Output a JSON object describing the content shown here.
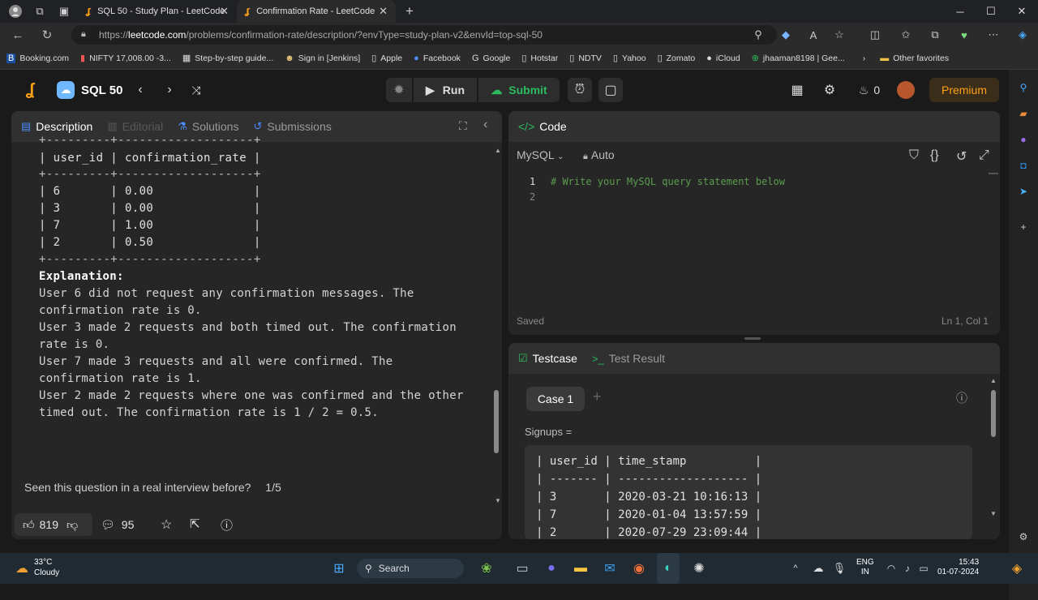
{
  "browser": {
    "tabs": [
      {
        "title": "SQL 50 - Study Plan - LeetCode"
      },
      {
        "title": "Confirmation Rate - LeetCode"
      }
    ],
    "url_prefix": "https://",
    "url_host": "leetcode.com",
    "url_path": "/problems/confirmation-rate/description/?envType=study-plan-v2&envId=top-sql-50",
    "bookmarks": [
      "Booking.com",
      "NIFTY 17,008.00 -3...",
      "Step-by-step guide...",
      "Sign in [Jenkins]",
      "Apple",
      "Facebook",
      "Google",
      "Hotstar",
      "NDTV",
      "Yahoo",
      "Zomato",
      "iCloud",
      "jhaaman8198 | Gee..."
    ],
    "other_favorites": "Other favorites"
  },
  "leetcode": {
    "study_plan": "SQL 50",
    "run_label": "Run",
    "submit_label": "Submit",
    "coins": "0",
    "premium_label": "Premium",
    "left_tabs": [
      "Description",
      "Editorial",
      "Solutions",
      "Submissions"
    ],
    "output_table": {
      "border": "+---------+-------------------+",
      "header": "| user_id | confirmation_rate |",
      "rows": [
        "| 6       | 0.00              |",
        "| 3       | 0.00              |",
        "| 7       | 1.00              |",
        "| 2       | 0.50              |"
      ]
    },
    "explanation_title": "Explanation:",
    "explanation_lines": [
      "User 6 did not request any confirmation messages. The",
      "confirmation rate is 0.",
      "User 3 made 2 requests and both timed out. The confirmation",
      "rate is 0.",
      "User 7 made 3 requests and all were confirmed. The",
      "confirmation rate is 1.",
      "User 2 made 2 requests where one was confirmed and the other",
      "timed out. The confirmation rate is 1 / 2 = 0.5."
    ],
    "interview_question": "Seen this question in a real interview before?",
    "interview_page": "1/5",
    "likes": "819",
    "comments": "95",
    "code": {
      "title": "Code",
      "language": "MySQL",
      "mode": "Auto",
      "lines": [
        "1",
        "2"
      ],
      "comment": "# Write your MySQL query statement below",
      "status": "Saved",
      "cursor": "Ln 1, Col 1"
    },
    "testcase": {
      "tab_testcase": "Testcase",
      "tab_result": "Test Result",
      "case_label": "Case 1",
      "add_label": "+",
      "input_name": "Signups =",
      "table_header": "| user_id | time_stamp          |",
      "table_sep": "| ------- | ------------------- |",
      "rows": [
        "| 3       | 2020-03-21 10:16:13 |",
        "| 7       | 2020-01-04 13:57:59 |",
        "| 2       | 2020-07-29 23:09:44 |"
      ]
    }
  },
  "taskbar": {
    "temp": "33°C",
    "weather": "Cloudy",
    "search": "Search",
    "lang1": "ENG",
    "lang2": "IN",
    "time": "15:43",
    "date": "01-07-2024"
  },
  "colors": {
    "accent_orange": "#ffa116",
    "submit_green": "#2cbb5d",
    "link_blue": "#4c8dff"
  }
}
